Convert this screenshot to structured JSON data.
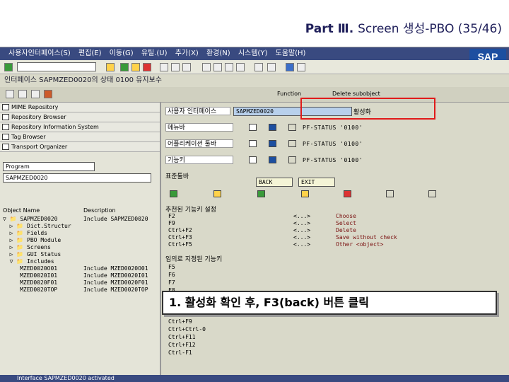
{
  "slide": {
    "title_prefix": "Part Ⅲ. ",
    "title_rest": "Screen 생성-PBO (35/46)"
  },
  "menu": [
    "사용자인터페이스(S)",
    "편집(E)",
    "이동(G)",
    "유틸.(U)",
    "추가(X)",
    "환경(N)",
    "시스템(Y)",
    "도움말(H)"
  ],
  "sap_logo": "SAP",
  "title_bar": "인터페이스 SAPMZED0020의 상태 0100 유지보수",
  "toolbar2": {
    "function_label": "Function",
    "delete_label": "Delete subobject"
  },
  "nav": [
    "MIME Repository",
    "Repository Browser",
    "Repository Information System",
    "Tag Browser",
    "Transport Organizer"
  ],
  "program_dropdown": "Program",
  "program_value": "SAPMZED0020",
  "tree": {
    "headers": [
      "Object Name",
      "Description"
    ],
    "rows": [
      [
        "SAPMZED0020",
        "Include SAPMZED0020"
      ],
      [
        "Dict.Structur",
        ""
      ],
      [
        "Fields",
        ""
      ],
      [
        "PBO Module",
        ""
      ],
      [
        "Screens",
        ""
      ],
      [
        "GUI Status",
        ""
      ],
      [
        "Includes",
        ""
      ],
      [
        "MZED0020O01",
        "Include MZED0020O01"
      ],
      [
        "MZED0020I01",
        "Include MZED0020I01"
      ],
      [
        "MZED0020F01",
        "Include MZED0020F01"
      ],
      [
        "MZED0020TOP",
        "Include MZED0020TOP"
      ]
    ]
  },
  "main": {
    "interface_label": "사용자 인터페이스",
    "interface_value": "SAPMZED0020",
    "active_label": "활성화",
    "rows": [
      {
        "label": "메뉴바",
        "status": "PF-STATUS '0100'"
      },
      {
        "label": "어플리케이션 툴바",
        "status": "PF-STATUS '0100'"
      },
      {
        "label": "기능키",
        "status": "PF-STATUS '0100'"
      }
    ],
    "standard_toolbar": "표준툴바",
    "back": "BACK",
    "exit": "EXIT",
    "recommended": "추천된 기능키 설정",
    "rec_keys": [
      {
        "key": "F2",
        "sym": "<...>",
        "act": "Choose"
      },
      {
        "key": "F9",
        "sym": "<...>",
        "act": "Select"
      },
      {
        "key": "Ctrl+F2",
        "sym": "<...>",
        "act": "Delete"
      },
      {
        "key": "Ctrl+F3",
        "sym": "<...>",
        "act": "Save without check"
      },
      {
        "key": "Ctrl+F5",
        "sym": "<...>",
        "act": "Other <object>"
      }
    ],
    "free_keys_title": "임의로 지정된 기능키",
    "free_keys": [
      "F5",
      "F6",
      "F7",
      "F8",
      "Ctrl+F9",
      "Ctrl+Ctrl-0",
      "Ctrl+F11",
      "Ctrl+F12",
      "Ctrl-F1"
    ]
  },
  "status_bar": "Interface SAPMZED0020 activated",
  "callout": "1. 활성화 확인 후, F3(back) 버튼 클릭",
  "colors": {
    "menubar": "#394a80",
    "highlight": "#e01a1a",
    "status_blue": "#1d4fa0"
  }
}
